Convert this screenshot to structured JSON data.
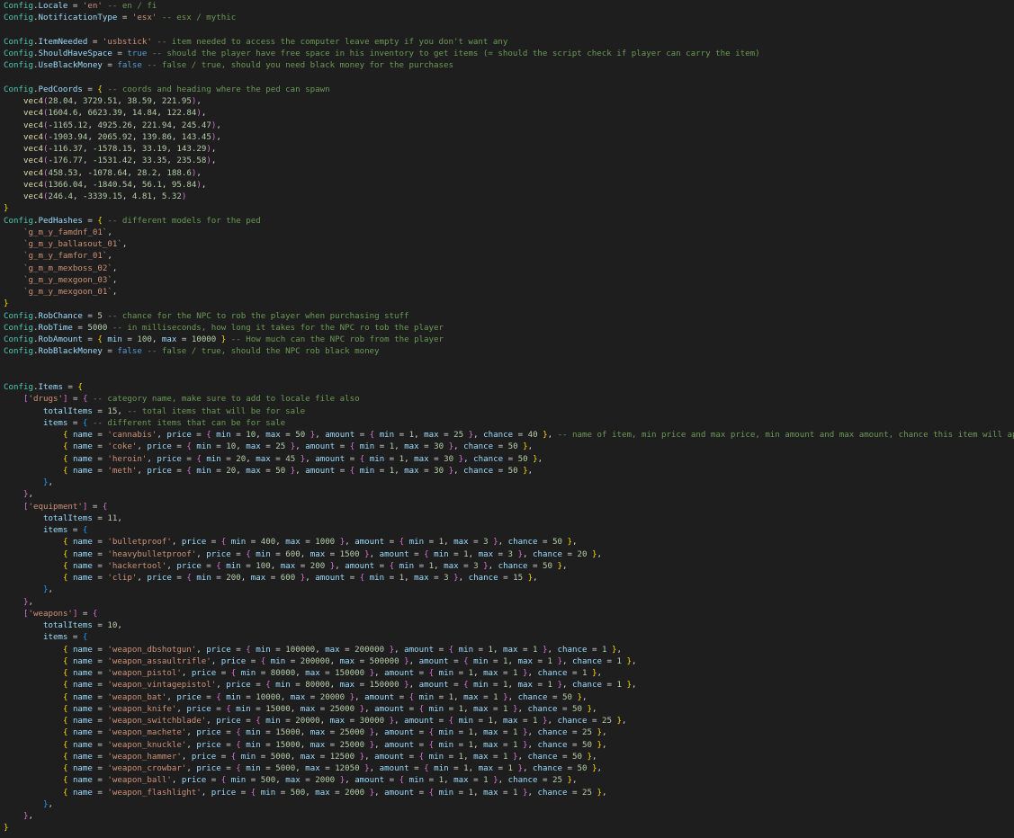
{
  "editor": {
    "language": "lua",
    "lines": [
      "Config.Locale = 'en' -- en / fi",
      "Config.NotificationType = 'esx' -- esx / mythic",
      "",
      "Config.ItemNeeded = 'usbstick' -- item needed to access the computer leave empty if you don't want any",
      "Config.ShouldHaveSpace = true -- should the player have free space in his inventory to get items (= should the script check if player can carry the item)",
      "Config.UseBlackMoney = false -- false / true, should you need black money for the purchases",
      "",
      "Config.PedCoords = { -- coords and heading where the ped can spawn",
      "    vec4(28.04, 3729.51, 38.59, 221.95),",
      "    vec4(1604.6, 6623.39, 14.84, 122.84),",
      "    vec4(-1165.12, 4925.26, 221.94, 245.47),",
      "    vec4(-1903.94, 2065.92, 139.86, 143.45),",
      "    vec4(-116.37, -1578.15, 33.19, 143.29),",
      "    vec4(-176.77, -1531.42, 33.35, 235.58),",
      "    vec4(458.53, -1078.64, 28.2, 188.6),",
      "    vec4(1366.04, -1840.54, 56.1, 95.84),",
      "    vec4(246.4, -3339.15, 4.81, 5.32)",
      "}",
      "Config.PedHashes = { -- different models for the ped",
      "    `g_m_y_famdnf_01`,",
      "    `g_m_y_ballasout_01`,",
      "    `g_m_y_famfor_01`,",
      "    `g_m_m_mexboss_02`,",
      "    `g_m_y_mexgoon_03`,",
      "    `g_m_y_mexgoon_01`,",
      "}",
      "Config.RobChance = 5 -- chance for the NPC to rob the player when purchasing stuff",
      "Config.RobTime = 5000 -- in milliseconds, how long it takes for the NPC ro tob the player",
      "Config.RobAmount = { min = 100, max = 10000 } -- How much can the NPC rob from the player",
      "Config.RobBlackMoney = false -- false / true, should the NPC rob black money",
      "",
      "",
      "Config.Items = {",
      "    ['drugs'] = { -- category name, make sure to add to locale file also",
      "        totalItems = 15, -- total items that will be for sale",
      "        items = { -- different items that can be for sale",
      "            { name = 'cannabis', price = { min = 10, max = 50 }, amount = { min = 1, max = 25 }, chance = 40 }, -- name of item, min price and max price, min amount and max amount, chance this item will appear",
      "            { name = 'coke', price = { min = 10, max = 25 }, amount = { min = 1, max = 30 }, chance = 50 },",
      "            { name = 'heroin', price = { min = 20, max = 45 }, amount = { min = 1, max = 30 }, chance = 50 },",
      "            { name = 'meth', price = { min = 20, max = 50 }, amount = { min = 1, max = 30 }, chance = 50 },",
      "        },",
      "    },",
      "    ['equipment'] = {",
      "        totalItems = 11,",
      "        items = {",
      "            { name = 'bulletproof', price = { min = 400, max = 1000 }, amount = { min = 1, max = 3 }, chance = 50 },",
      "            { name = 'heavybulletproof', price = { min = 600, max = 1500 }, amount = { min = 1, max = 3 }, chance = 20 },",
      "            { name = 'hackertool', price = { min = 100, max = 200 }, amount = { min = 1, max = 3 }, chance = 50 },",
      "            { name = 'clip', price = { min = 200, max = 600 }, amount = { min = 1, max = 3 }, chance = 15 },",
      "        },",
      "    },",
      "    ['weapons'] = {",
      "        totalItems = 10,",
      "        items = {",
      "            { name = 'weapon_dbshotgun', price = { min = 100000, max = 200000 }, amount = { min = 1, max = 1 }, chance = 1 },",
      "            { name = 'weapon_assaultrifle', price = { min = 200000, max = 500000 }, amount = { min = 1, max = 1 }, chance = 1 },",
      "            { name = 'weapon_pistol', price = { min = 80000, max = 150000 }, amount = { min = 1, max = 1 }, chance = 1 },",
      "            { name = 'weapon_vintagepistol', price = { min = 80000, max = 150000 }, amount = { min = 1, max = 1 }, chance = 1 },",
      "            { name = 'weapon_bat', price = { min = 10000, max = 20000 }, amount = { min = 1, max = 1 }, chance = 50 },",
      "            { name = 'weapon_knife', price = { min = 15000, max = 25000 }, amount = { min = 1, max = 1 }, chance = 50 },",
      "            { name = 'weapon_switchblade', price = { min = 20000, max = 30000 }, amount = { min = 1, max = 1 }, chance = 25 },",
      "            { name = 'weapon_machete', price = { min = 15000, max = 25000 }, amount = { min = 1, max = 1 }, chance = 25 },",
      "            { name = 'weapon_knuckle', price = { min = 15000, max = 25000 }, amount = { min = 1, max = 1 }, chance = 50 },",
      "            { name = 'weapon_hammer', price = { min = 5000, max = 12500 }, amount = { min = 1, max = 1 }, chance = 50 },",
      "            { name = 'weapon_crowbar', price = { min = 5000, max = 12050 }, amount = { min = 1, max = 1 }, chance = 50 },",
      "            { name = 'weapon_ball', price = { min = 500, max = 2000 }, amount = { min = 1, max = 1 }, chance = 25 },",
      "            { name = 'weapon_flashlight', price = { min = 500, max = 2000 }, amount = { min = 1, max = 1 }, chance = 25 },",
      "        },",
      "    },",
      "}"
    ]
  },
  "theme": {
    "background": "#1e1e1e",
    "config_table": "#4ec9b0",
    "property": "#9cdcfe",
    "string": "#ce9178",
    "number": "#b5cea8",
    "keyword": "#569cd6",
    "function": "#dcdcaa",
    "comment": "#6a9955",
    "bracket_level_1": "#ffd700",
    "bracket_level_2": "#da70d6",
    "bracket_level_3": "#179fff"
  }
}
